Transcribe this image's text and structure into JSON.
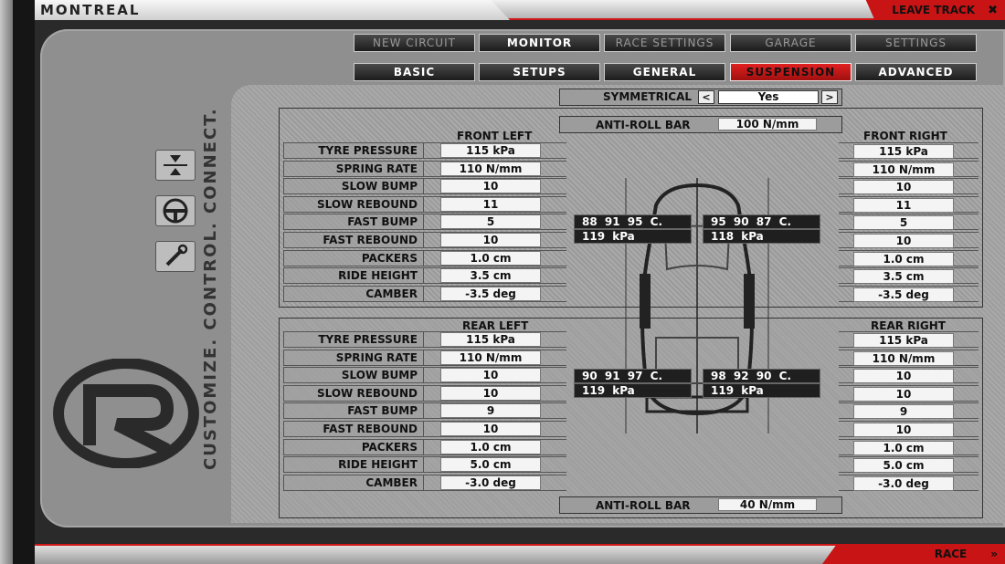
{
  "topbar": {
    "track": "MONTREAL",
    "leave_label": "LEAVE TRACK",
    "leave_icon": "close-icon"
  },
  "bottombar": {
    "race_label": "RACE",
    "race_icon": "double-chevron-right-icon"
  },
  "nav": {
    "main": [
      {
        "label": "NEW CIRCUIT",
        "active": false
      },
      {
        "label": "MONITOR",
        "active": true
      },
      {
        "label": "RACE SETTINGS",
        "active": false
      },
      {
        "label": "GARAGE",
        "active": false
      },
      {
        "label": "SETTINGS",
        "active": false
      }
    ],
    "sub": [
      {
        "label": "BASIC",
        "active": false
      },
      {
        "label": "SETUPS",
        "active": false
      },
      {
        "label": "GENERAL",
        "active": false
      },
      {
        "label": "SUSPENSION",
        "active": true
      },
      {
        "label": "ADVANCED",
        "active": false
      }
    ]
  },
  "sidebar": {
    "slogan": "CUSTOMIZE. CONTROL. CONNECT.",
    "icons": [
      "compress-arrows-icon",
      "steering-wheel-icon",
      "wrench-icon"
    ]
  },
  "symmetrical": {
    "label": "SYMMETRICAL",
    "value": "Yes",
    "prev": "<",
    "next": ">"
  },
  "front": {
    "left_header": "FRONT LEFT",
    "right_header": "FRONT RIGHT",
    "anti_roll_label": "ANTI-ROLL BAR",
    "anti_roll_value": "100 N/mm",
    "rows": [
      {
        "label": "TYRE PRESSURE",
        "left": "115 kPa",
        "right": "115 kPa"
      },
      {
        "label": "SPRING RATE",
        "left": "110 N/mm",
        "right": "110 N/mm"
      },
      {
        "label": "SLOW BUMP",
        "left": "10",
        "right": "10"
      },
      {
        "label": "SLOW REBOUND",
        "left": "11",
        "right": "11"
      },
      {
        "label": "FAST BUMP",
        "left": "5",
        "right": "5"
      },
      {
        "label": "FAST REBOUND",
        "left": "10",
        "right": "10"
      },
      {
        "label": "PACKERS",
        "left": "1.0 cm",
        "right": "1.0 cm"
      },
      {
        "label": "RIDE HEIGHT",
        "left": "3.5 cm",
        "right": "3.5 cm"
      },
      {
        "label": "CAMBER",
        "left": "-3.5 deg",
        "right": "-3.5 deg"
      }
    ],
    "tyre_left": {
      "temps": "88 91 95 C.",
      "pressure": "119 kPa"
    },
    "tyre_right": {
      "temps": "95 90 87 C.",
      "pressure": "118 kPa"
    }
  },
  "rear": {
    "left_header": "REAR LEFT",
    "right_header": "REAR RIGHT",
    "anti_roll_label": "ANTI-ROLL BAR",
    "anti_roll_value": "40 N/mm",
    "rows": [
      {
        "label": "TYRE PRESSURE",
        "left": "115 kPa",
        "right": "115 kPa"
      },
      {
        "label": "SPRING RATE",
        "left": "110 N/mm",
        "right": "110 N/mm"
      },
      {
        "label": "SLOW BUMP",
        "left": "10",
        "right": "10"
      },
      {
        "label": "SLOW REBOUND",
        "left": "10",
        "right": "10"
      },
      {
        "label": "FAST BUMP",
        "left": "9",
        "right": "9"
      },
      {
        "label": "FAST REBOUND",
        "left": "10",
        "right": "10"
      },
      {
        "label": "PACKERS",
        "left": "1.0 cm",
        "right": "1.0 cm"
      },
      {
        "label": "RIDE HEIGHT",
        "left": "5.0 cm",
        "right": "5.0 cm"
      },
      {
        "label": "CAMBER",
        "left": "-3.0 deg",
        "right": "-3.0 deg"
      }
    ],
    "tyre_left": {
      "temps": "90 91 97 C.",
      "pressure": "119 kPa"
    },
    "tyre_right": {
      "temps": "98 92 90 C.",
      "pressure": "119 kPa"
    }
  },
  "colors": {
    "accent_red": "#c81414",
    "panel_gray": "#8f8f8f"
  }
}
